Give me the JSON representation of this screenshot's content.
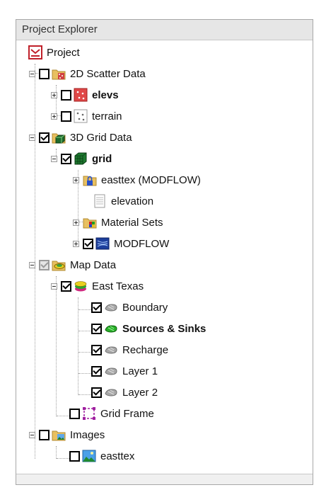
{
  "panel": {
    "title": "Project Explorer"
  },
  "tree": {
    "project": "Project",
    "scatter": {
      "label": "2D Scatter Data",
      "elevs": "elevs",
      "terrain": "terrain"
    },
    "grid3d": {
      "label": "3D Grid Data",
      "grid": "grid",
      "easttex_modflow": "easttex (MODFLOW)",
      "elevation": "elevation",
      "material_sets": "Material Sets",
      "modflow": "MODFLOW"
    },
    "map": {
      "label": "Map Data",
      "east_texas": "East Texas",
      "boundary": "Boundary",
      "sources_sinks": "Sources & Sinks",
      "recharge": "Recharge",
      "layer1": "Layer 1",
      "layer2": "Layer 2",
      "grid_frame": "Grid Frame"
    },
    "images": {
      "label": "Images",
      "easttex": "easttex"
    }
  },
  "icons": [
    "project-icon",
    "folder-scatter-icon",
    "scatter-red-icon",
    "scatter-white-icon",
    "folder-grid-icon",
    "grid-cube-icon",
    "folder-lock-icon",
    "document-icon",
    "folder-materials-icon",
    "modflow-icon",
    "folder-map-icon",
    "layers-icon",
    "coverage-gray-icon",
    "coverage-green-icon",
    "grid-frame-icon",
    "folder-images-icon",
    "image-icon"
  ]
}
